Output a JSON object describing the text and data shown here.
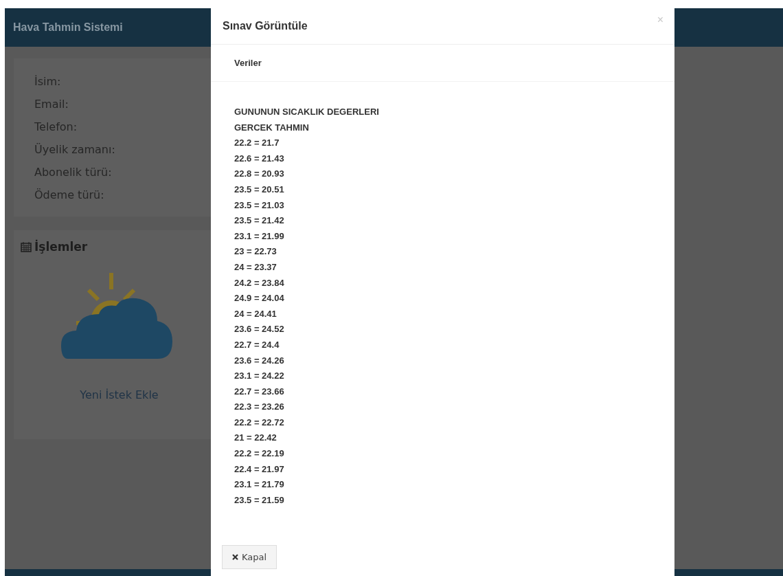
{
  "header": {
    "title": "Hava Tahmin Sistemi"
  },
  "profile": {
    "fields": [
      "İsim:",
      "Email:",
      "Telefon:",
      "Üyelik zamanı:",
      "Abonelik türü:",
      "Ödeme türü:"
    ]
  },
  "actions_panel": {
    "title": "İşlemler",
    "link": "Yeni İstek Ekle"
  },
  "modal": {
    "title": "Sınav Görüntüle",
    "close": "×",
    "section": "Veriler",
    "lines": [
      "GUNUNUN SICAKLIK DEGERLERI",
      "GERCEK TAHMIN",
      "22.2 = 21.7",
      "22.6 = 21.43",
      "22.8 = 20.93",
      "23.5 = 20.51",
      "23.5 = 21.03",
      "23.5 = 21.42",
      "23.1 = 21.99",
      "23 = 22.73",
      "24 = 23.37",
      "24.2 = 23.84",
      "24.9 = 24.04",
      "24 = 24.41",
      "23.6 = 24.52",
      "22.7 = 24.4",
      "23.6 = 24.26",
      "23.1 = 24.22",
      "22.7 = 23.66",
      "22.3 = 23.26",
      "22.2 = 22.72",
      "21 = 22.42",
      "22.2 = 22.19",
      "22.4 = 21.97",
      "23.1 = 21.79",
      "23.5 = 21.59"
    ],
    "close_button": "Kapal"
  }
}
